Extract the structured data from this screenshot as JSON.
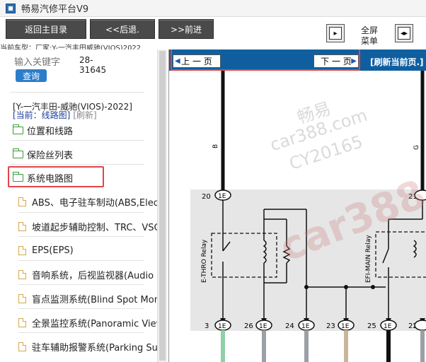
{
  "window": {
    "title": "畅易汽修平台V9"
  },
  "toolbar": {
    "back_main": "返回主目录",
    "prev": "<<后退.",
    "next": ">>前进",
    "fullscreen": "全屏\n菜单"
  },
  "car_type_line": "当前车型：厂家:Y-一汽丰田威驰(VIOS)2022",
  "sidebar": {
    "search_placeholder": "输入关键字",
    "search_button": "查询",
    "code": "28-31645",
    "vehicle": "[Y-一汽丰田-威驰(VIOS)-2022]",
    "current": "[当前：线路图]",
    "refresh": "[刷新]",
    "folders": [
      {
        "label": "位置和线路"
      },
      {
        "label": "保险丝列表"
      },
      {
        "label": "系统电路图"
      }
    ],
    "items": [
      {
        "label": "ABS、电子驻车制动(ABS,Electric"
      },
      {
        "label": "坡道起步辅助控制、TRC、VSC"
      },
      {
        "label": "EPS(EPS)"
      },
      {
        "label": "音响系统，后视监视器(Audio S"
      },
      {
        "label": "盲点监测系统(Blind Spot Mon"
      },
      {
        "label": "全景监控系统(Panoramic View"
      },
      {
        "label": "驻车辅助报警系统(Parking Sup"
      }
    ]
  },
  "viewer": {
    "prev_page": "上 一 页",
    "next_page": "下 一 页",
    "refresh_page": "[刷新当前页.]",
    "watermark": {
      "line1": "畅易",
      "line2": "car388.com",
      "line3": "CY20165",
      "big": "car388.c"
    },
    "diagram": {
      "wire_left": "B",
      "wire_right": "G",
      "pin_top_left": "20",
      "pin_top_right": "21",
      "connector": "1E",
      "relay1": "E-THRO Relay",
      "relay2": "EFI-MAIN Relay",
      "bottom_pins": [
        "3",
        "26",
        "24",
        "23",
        "25",
        "22"
      ]
    }
  },
  "colors": {
    "navbar": "#0f5fa0",
    "highlight": "#e0454a",
    "button": "#4a4a4a",
    "search": "#2d7ec9"
  }
}
